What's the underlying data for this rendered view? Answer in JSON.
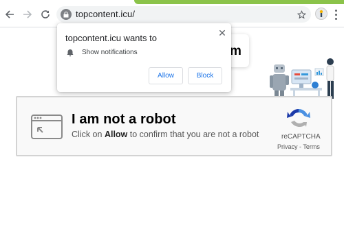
{
  "browser": {
    "url": "topcontent.icu/",
    "icons": {
      "back": "arrow-back-icon",
      "forward": "arrow-forward-icon",
      "reload": "reload-icon",
      "lock": "lock-icon",
      "bookmark": "star-icon",
      "profile": "profile-icon",
      "menu": "kebab-menu-icon"
    }
  },
  "background_card": {
    "text": "m"
  },
  "notification_popup": {
    "title": "topcontent.icu wants to",
    "permission_label": "Show notifications",
    "allow_label": "Allow",
    "block_label": "Block",
    "close_symbol": "✕",
    "accent_color": "#1a73e8"
  },
  "captcha": {
    "title": "I am not a robot",
    "subtitle_prefix": "Click on",
    "subtitle_bold": "Allow",
    "subtitle_suffix": "to confirm that you are not a robot",
    "brand_label": "reCAPTCHA",
    "privacy_terms": "Privacy - Terms",
    "border_color": "#d3d3d3",
    "logo_colors": [
      "#4a90e2",
      "#1c3aa9",
      "#b0b0b0"
    ]
  }
}
